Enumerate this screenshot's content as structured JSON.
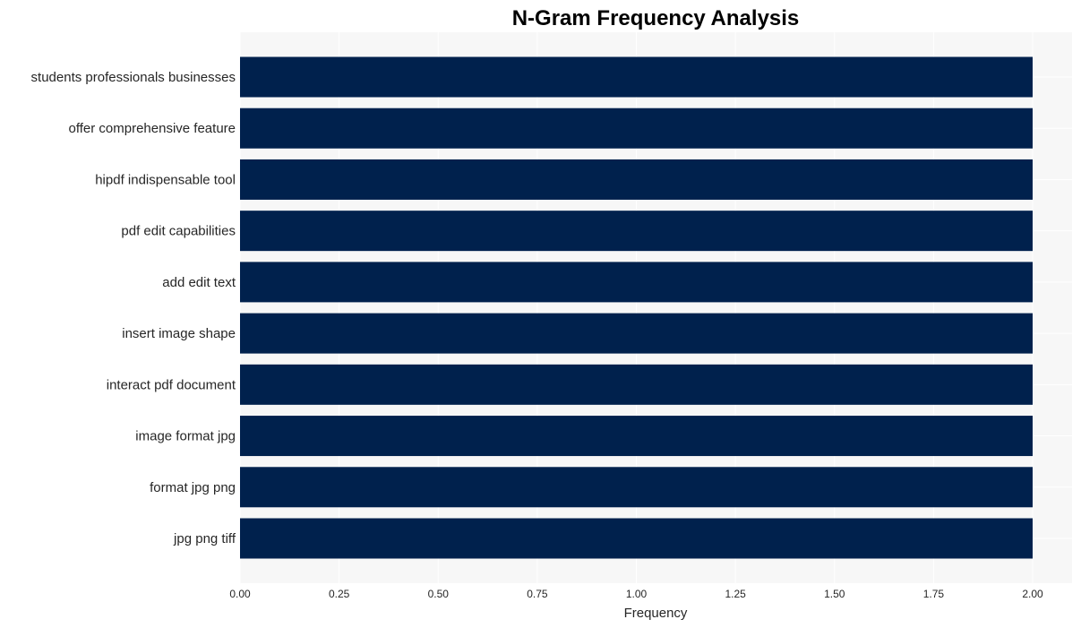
{
  "chart_data": {
    "type": "bar",
    "orientation": "horizontal",
    "title": "N-Gram Frequency Analysis",
    "xlabel": "Frequency",
    "ylabel": "",
    "categories": [
      "students professionals businesses",
      "offer comprehensive feature",
      "hipdf indispensable tool",
      "pdf edit capabilities",
      "add edit text",
      "insert image shape",
      "interact pdf document",
      "image format jpg",
      "format jpg png",
      "jpg png tiff"
    ],
    "values": [
      2,
      2,
      2,
      2,
      2,
      2,
      2,
      2,
      2,
      2
    ],
    "xlim": [
      0,
      2.1
    ],
    "xticks": [
      0,
      0.25,
      0.5,
      0.75,
      1.0,
      1.25,
      1.5,
      1.75,
      2.0
    ],
    "xtick_labels": [
      "0.00",
      "0.25",
      "0.50",
      "0.75",
      "1.00",
      "1.25",
      "1.50",
      "1.75",
      "2.00"
    ],
    "grid": true,
    "legend": "none",
    "colors": {
      "bar": "#00214d",
      "plot_background": "#f7f7f7",
      "grid": "#ffffff"
    }
  }
}
